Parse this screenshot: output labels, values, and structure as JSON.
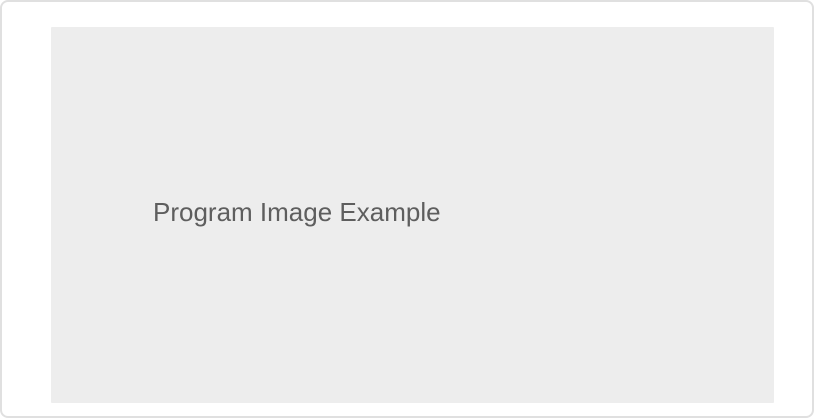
{
  "program_image": {
    "placeholder_label": "Program Image Example"
  },
  "colors": {
    "card_border": "#e0e0e0",
    "placeholder_background": "#ededed",
    "placeholder_text": "#5e5e5e"
  }
}
